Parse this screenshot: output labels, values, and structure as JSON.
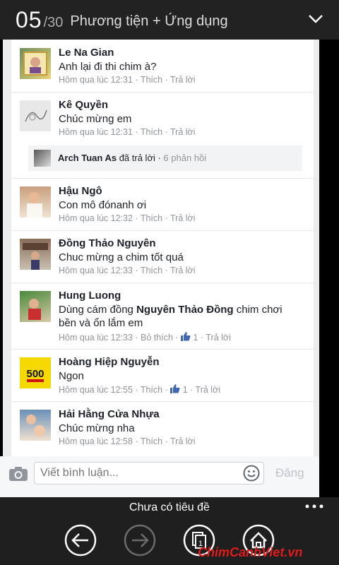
{
  "header": {
    "current": "05",
    "total": "/30",
    "title": "Phương tiện + Ứng dụng"
  },
  "comments": [
    {
      "name": "Le Na Gian",
      "text": "Anh lại đi thi chim à?",
      "time": "Hôm qua lúc 12:31",
      "like": "Thích",
      "reply": "Trả lời"
    },
    {
      "name": "Kê Quyền",
      "text": "Chúc mừng em",
      "time": "Hôm qua lúc 12:31",
      "like": "Thích",
      "reply": "Trả lời"
    },
    {
      "name": "Hậu Ngô",
      "text": "Con mô đónanh ơi",
      "time": "Hôm qua lúc 12:32",
      "like": "Thích",
      "reply": "Trả lời"
    },
    {
      "name": "Đồng Thảo Nguyên",
      "text": "Chuc mừng a chim tốt quá",
      "time": "Hôm qua lúc 12:33",
      "like": "Thích",
      "reply": "Trả lời"
    },
    {
      "name": "Hung Luong",
      "text_pre": "Dùng cám đồng ",
      "text_bold": "Nguyên Thảo Đồng",
      "text_post": " chim chơi",
      "text2": "bền và ổn lắm em",
      "time": "Hôm qua lúc 12:33",
      "like": "Bỏ thích",
      "likes": "1",
      "reply": "Trả lời"
    },
    {
      "name": "Hoàng Hiệp Nguyễn",
      "text": "Ngon",
      "time": "Hôm qua lúc 12:55",
      "like": "Thích",
      "likes": "1",
      "reply": "Trả lời"
    },
    {
      "name": "Hải Hằng Cửa Nhựa",
      "text": "Chúc mừng nha",
      "time": "Hôm qua lúc 12:58",
      "like": "Thích",
      "reply": "Trả lời"
    }
  ],
  "reply_thread": {
    "name": "Arch Tuan As",
    "action": "đã trả lời",
    "count": "6 phản hồi"
  },
  "comment_input": {
    "placeholder": "Viết bình luận...",
    "post_label": "Đăng"
  },
  "bottom": {
    "title": "Chưa có tiêu đề"
  },
  "avatar_badge": "500",
  "watermark": "ChimCanhViet.vn",
  "colors": {
    "accent": "#4267b2",
    "link_gray": "#90949c",
    "watermark": "#e01b1b"
  }
}
